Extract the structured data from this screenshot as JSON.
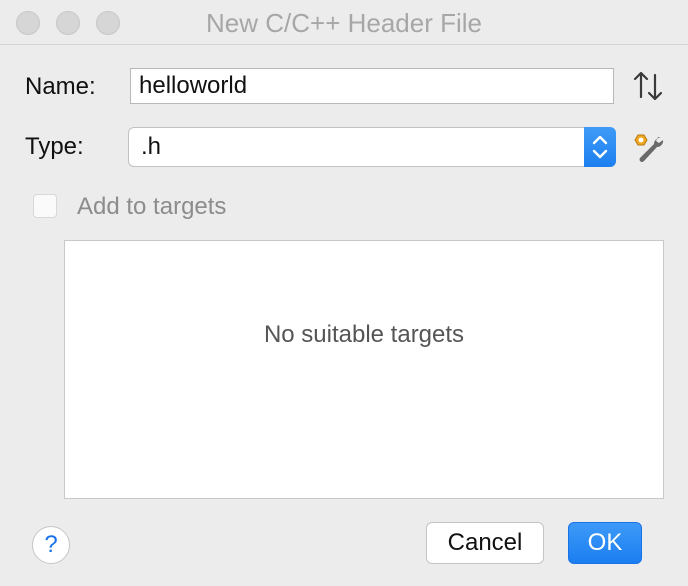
{
  "window": {
    "title": "New C/C++ Header File"
  },
  "form": {
    "name_label": "Name:",
    "name_value": "helloworld",
    "type_label": "Type:",
    "type_value": ".h",
    "add_to_targets_label": "Add to targets",
    "add_to_targets_checked": false
  },
  "targets": {
    "empty_text": "No suitable targets"
  },
  "footer": {
    "help_label": "?",
    "cancel_label": "Cancel",
    "ok_label": "OK"
  },
  "icons": {
    "sort": "sort-order-icon",
    "wrench": "wrench-settings-icon",
    "select_arrows": "chevron-up-down-icon"
  },
  "colors": {
    "accent": "#1b7ef1",
    "window_bg": "#ececec",
    "title_text": "#a7a7a7"
  }
}
